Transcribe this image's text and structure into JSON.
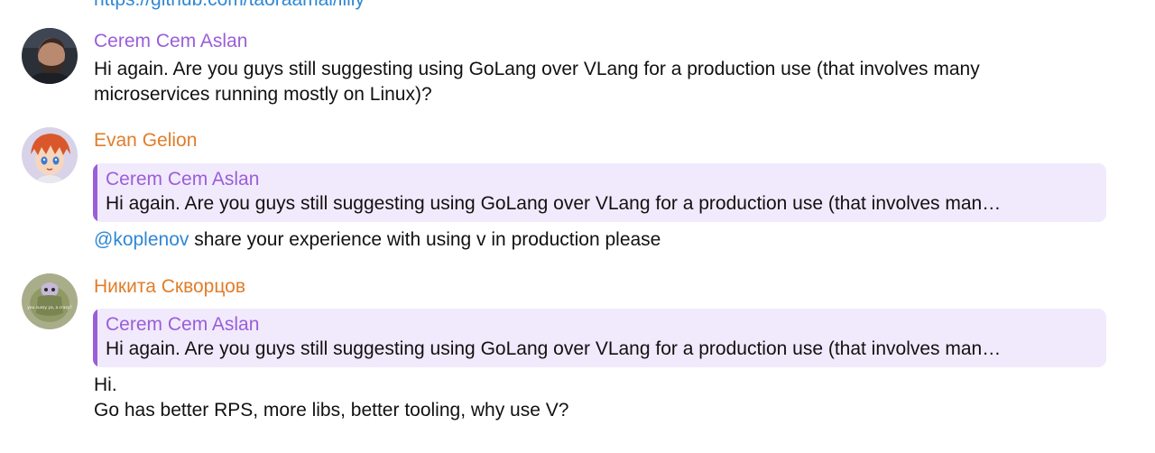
{
  "top_link": "https://github.com/taoraamal/lilly",
  "messages": [
    {
      "author": "Cerem Cem Aslan",
      "text_line1": "Hi again. Are you guys still suggesting using GoLang over VLang for a production use (that involves many",
      "text_line2": "microservices running mostly on Linux)?"
    },
    {
      "author": "Evan Gelion",
      "reply": {
        "author": "Cerem Cem Aslan",
        "text": "Hi again. Are you guys still suggesting using GoLang over VLang for a production use (that involves man…"
      },
      "mention": "@koplenov",
      "text": " share your experience with using v in production please"
    },
    {
      "author": "Никита Скворцов",
      "avatar_caption": "you sussy ya, a crazy?",
      "reply": {
        "author": "Cerem Cem Aslan",
        "text": "Hi again. Are you guys still suggesting using GoLang over VLang for a production use (that involves man…"
      },
      "text_line1": "Hi.",
      "text_line2": "Go has better RPS, more libs, better tooling, why use V?"
    }
  ],
  "colors": {
    "link": "#2f87d4",
    "author_purple": "#9a5ed9",
    "author_orange": "#e07d2a",
    "reply_bg": "#f1eafc"
  }
}
